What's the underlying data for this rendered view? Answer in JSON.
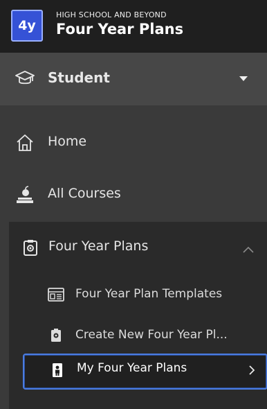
{
  "header": {
    "logo_text": "4y",
    "subtitle": "HIGH SCHOOL AND BEYOND",
    "title": "Four Year Plans"
  },
  "role": {
    "label": "Student",
    "icon": "graduation-cap-icon"
  },
  "nav": [
    {
      "label": "Home",
      "icon": "home-icon"
    },
    {
      "label": "All Courses",
      "icon": "courses-icon"
    }
  ],
  "group": {
    "label": "Four Year Plans",
    "icon": "plan-icon",
    "expanded": true,
    "items": [
      {
        "label": "Four Year Plan Templates",
        "icon": "template-icon"
      },
      {
        "label": "Create New Four Year Pl...",
        "icon": "create-plan-icon"
      },
      {
        "label": "My Four Year Plans",
        "icon": "person-plan-icon",
        "active": true
      }
    ]
  },
  "colors": {
    "accent": "#3552d6",
    "active_border": "#4a7ce0",
    "background": "#3a3a3a",
    "header": "#1f1f1f"
  }
}
